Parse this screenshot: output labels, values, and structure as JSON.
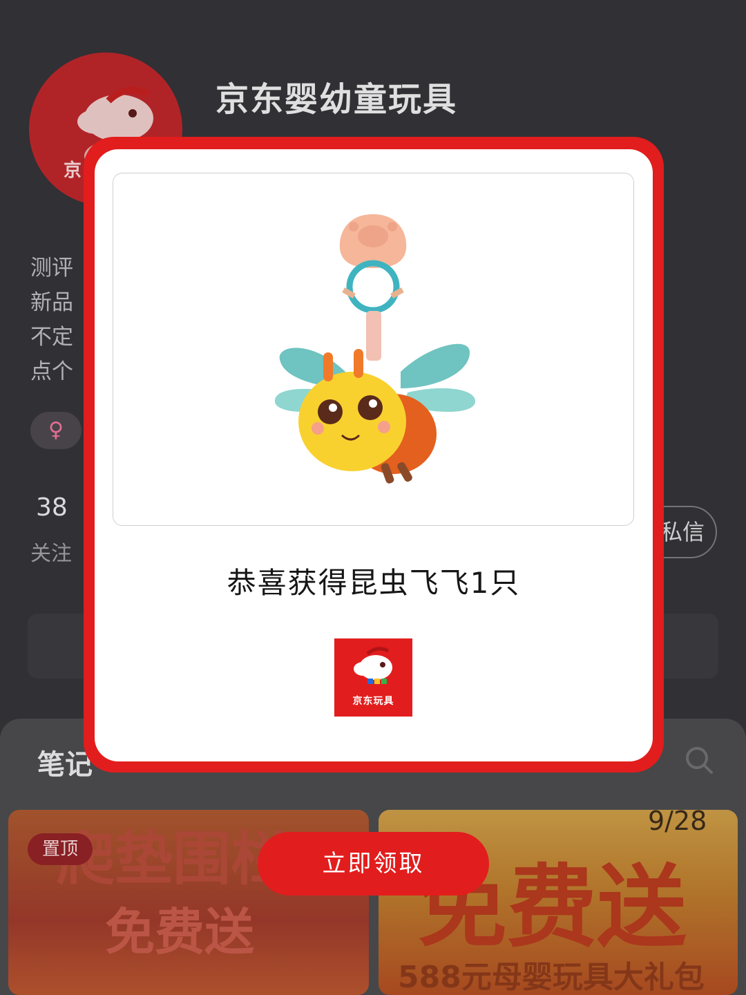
{
  "profile": {
    "name": "京东婴幼童玩具",
    "avatar_label": "京",
    "bio_lines": [
      "测评",
      "新品",
      "不定",
      "点个"
    ],
    "gender_symbol": "♀",
    "stats": {
      "following_count": "38",
      "following_label": "关注"
    },
    "message_button_label": "私信"
  },
  "feed": {
    "tab_label": "笔记",
    "pin_label": "置顶",
    "card_left_title_1": "爬垫围栏",
    "card_left_title_2": "免费送",
    "card_right_date": "9/28",
    "card_right_title": "免费送",
    "card_right_subtitle": "588元母婴玩具大礼包"
  },
  "modal": {
    "prize_text": "恭喜获得昆虫飞飞1只",
    "brand_label": "京东玩具",
    "claim_button_label": "立即领取"
  },
  "colors": {
    "accent_red": "#e21d1d",
    "background": "#333237"
  },
  "icons": {
    "search": "search-icon",
    "product": "bee-toy-image",
    "logo": "jd-dog-logo"
  }
}
